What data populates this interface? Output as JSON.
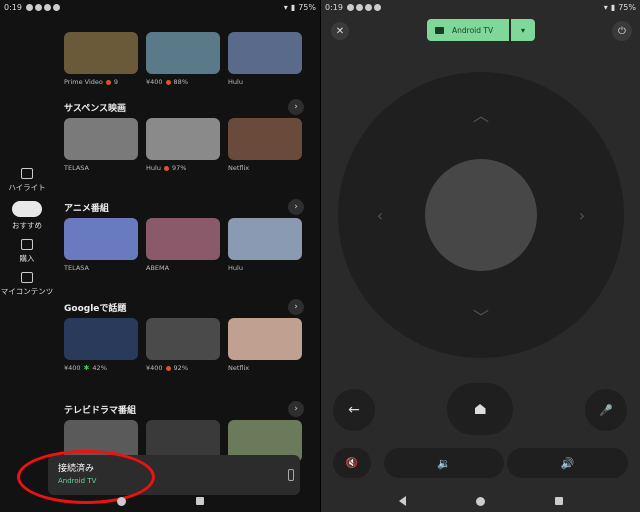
{
  "status_left": {
    "time": "0:19",
    "battery": "75%"
  },
  "status_right": {
    "time": "0:19",
    "battery": "75%"
  },
  "rail": [
    {
      "label": "ハイライト"
    },
    {
      "label": "おすすめ"
    },
    {
      "label": "購入"
    },
    {
      "label": "マイコンテンツ"
    }
  ],
  "sections": [
    {
      "title": "",
      "tiles": [
        {
          "meta": "Prime Video",
          "extra": "9",
          "color": "#6b5a3a"
        },
        {
          "meta": "¥400",
          "extra": "88%",
          "color": "#5a7a8a"
        },
        {
          "meta": "Hulu",
          "extra": "",
          "color": "#5a6a8a"
        }
      ]
    },
    {
      "title": "サスペンス映画",
      "tiles": [
        {
          "meta": "TELASA",
          "extra": "",
          "color": "#7a7a7a"
        },
        {
          "meta": "Hulu",
          "extra": "97%",
          "color": "#8a8a8a"
        },
        {
          "meta": "Netflix",
          "extra": "",
          "color": "#6a4a3a"
        }
      ]
    },
    {
      "title": "アニメ番組",
      "tiles": [
        {
          "meta": "TELASA",
          "extra": "",
          "color": "#6a7ac0"
        },
        {
          "meta": "ABEMA",
          "extra": "",
          "color": "#8a5a6a"
        },
        {
          "meta": "Hulu",
          "extra": "",
          "color": "#8a9ab0"
        }
      ]
    },
    {
      "title": "Googleで話題",
      "tiles": [
        {
          "meta": "¥400",
          "extra": "42%",
          "color": "#2a3a5a"
        },
        {
          "meta": "¥400",
          "extra": "92%",
          "color": "#4a4a4a"
        },
        {
          "meta": "Netflix",
          "extra": "",
          "color": "#c0a090"
        }
      ]
    },
    {
      "title": "テレビドラマ番組",
      "tiles": [
        {
          "meta": "",
          "extra": "",
          "color": "#5a5a5a"
        },
        {
          "meta": "",
          "extra": "",
          "color": "#3a3a3a"
        },
        {
          "meta": "",
          "extra": "",
          "color": "#6a7a5a"
        }
      ]
    }
  ],
  "toast": {
    "title": "接続済み",
    "subtitle": "Android TV"
  },
  "remote": {
    "device": "Android TV",
    "close": "✕",
    "power": "⏻",
    "back": "←",
    "mic": "🎤",
    "mute": "🔇",
    "voldown": "🔉",
    "volup": "🔊"
  },
  "colors": {
    "accent": "#7fd79a",
    "highlight": "#ee1111"
  }
}
